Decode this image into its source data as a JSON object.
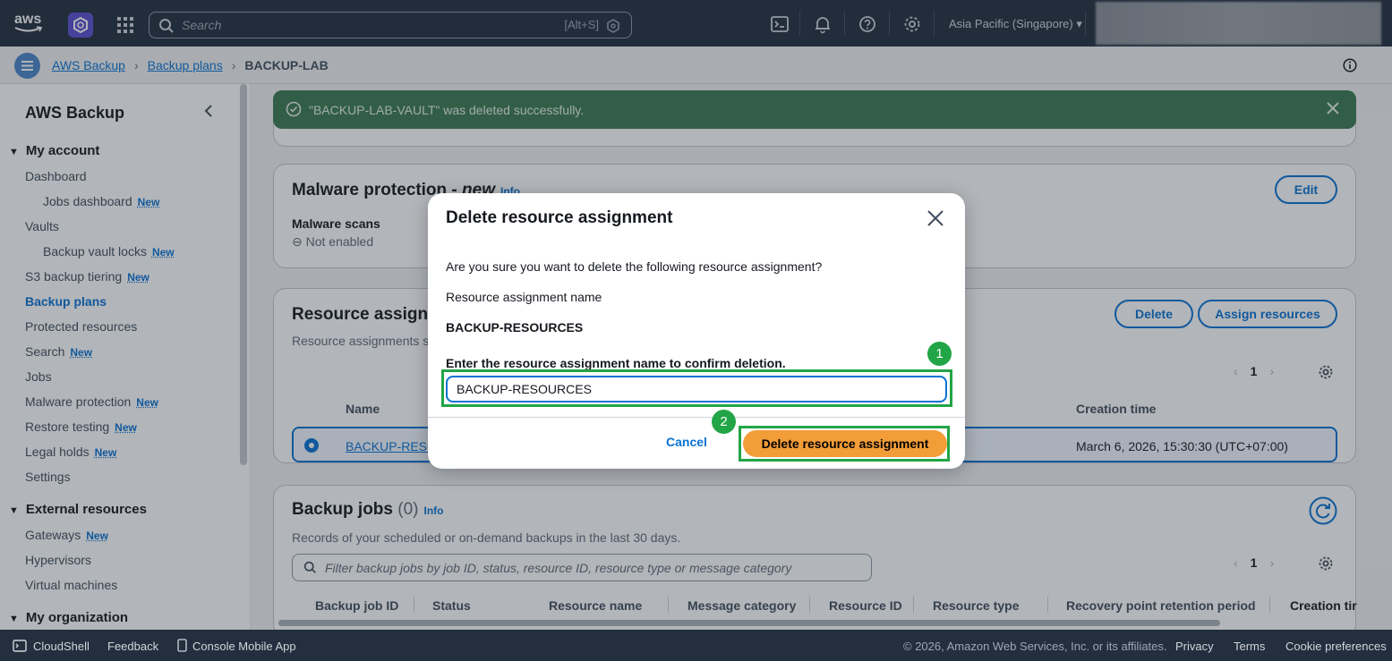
{
  "topnav": {
    "logo_text": "aws",
    "search_placeholder": "Search",
    "search_shortcut": "[Alt+S]",
    "region": "Asia Pacific (Singapore) ▾",
    "icons": [
      "cloudshell-icon",
      "bell-icon",
      "help-icon",
      "gear-icon"
    ]
  },
  "breadcrumb": {
    "items": [
      "AWS Backup",
      "Backup plans"
    ],
    "current": "BACKUP-LAB"
  },
  "sidebar": {
    "title": "AWS Backup",
    "sections": {
      "my_account": "My account",
      "external_resources": "External resources",
      "my_organization": "My organization"
    },
    "items": {
      "dashboard": "Dashboard",
      "jobs_dashboard": "Jobs dashboard",
      "vaults": "Vaults",
      "backup_vault_locks": "Backup vault locks",
      "s3_backup_tiering": "S3 backup tiering",
      "backup_plans": "Backup plans",
      "protected_resources": "Protected resources",
      "search": "Search",
      "jobs": "Jobs",
      "malware_protection": "Malware protection",
      "restore_testing": "Restore testing",
      "legal_holds": "Legal holds",
      "settings": "Settings",
      "gateways": "Gateways",
      "hypervisors": "Hypervisors",
      "virtual_machines": "Virtual machines"
    },
    "new_badge": "New"
  },
  "flash": {
    "message": "\"BACKUP-LAB-VAULT\" was deleted successfully.",
    "color": "#3b7a50"
  },
  "malware": {
    "title": "Malware protection - ",
    "title_em": "new",
    "info": "Info",
    "edit": "Edit",
    "scans_label": "Malware scans",
    "scans_value": "Not enabled"
  },
  "resource_assignments": {
    "title": "Resource assignm",
    "subtitle": "Resource assignments sp",
    "delete": "Delete",
    "assign": "Assign resources",
    "page": "1",
    "col_name": "Name",
    "col_creation": "Creation time",
    "row_name": "BACKUP-RESO",
    "row_creation": "March 6, 2026, 15:30:30 (UTC+07:00)"
  },
  "backup_jobs": {
    "title": "Backup jobs",
    "count": "(0)",
    "info": "Info",
    "subtitle": "Records of your scheduled or on-demand backups in the last 30 days.",
    "filter_placeholder": "Filter backup jobs by job ID, status, resource ID, resource type or message category",
    "page": "1",
    "columns": [
      "Backup job ID",
      "Status",
      "Resource name",
      "Message category",
      "Resource ID",
      "Resource type",
      "Recovery point retention period",
      "Creation tir"
    ]
  },
  "modal": {
    "title": "Delete resource assignment",
    "question": "Are you sure you want to delete the following resource assignment?",
    "name_label": "Resource assignment name",
    "name_value": "BACKUP-RESOURCES",
    "confirm_label": "Enter the resource assignment name to confirm deletion.",
    "input_value": "BACKUP-RESOURCES",
    "cancel": "Cancel",
    "delete": "Delete resource assignment",
    "step1": "1",
    "step2": "2",
    "highlight_color": "#22a546",
    "danger_color": "#f29d38"
  },
  "footer": {
    "cloudshell": "CloudShell",
    "feedback": "Feedback",
    "mobile": "Console Mobile App",
    "copyright": "© 2026, Amazon Web Services, Inc. or its affiliates.",
    "privacy": "Privacy",
    "terms": "Terms",
    "cookies": "Cookie preferences"
  }
}
